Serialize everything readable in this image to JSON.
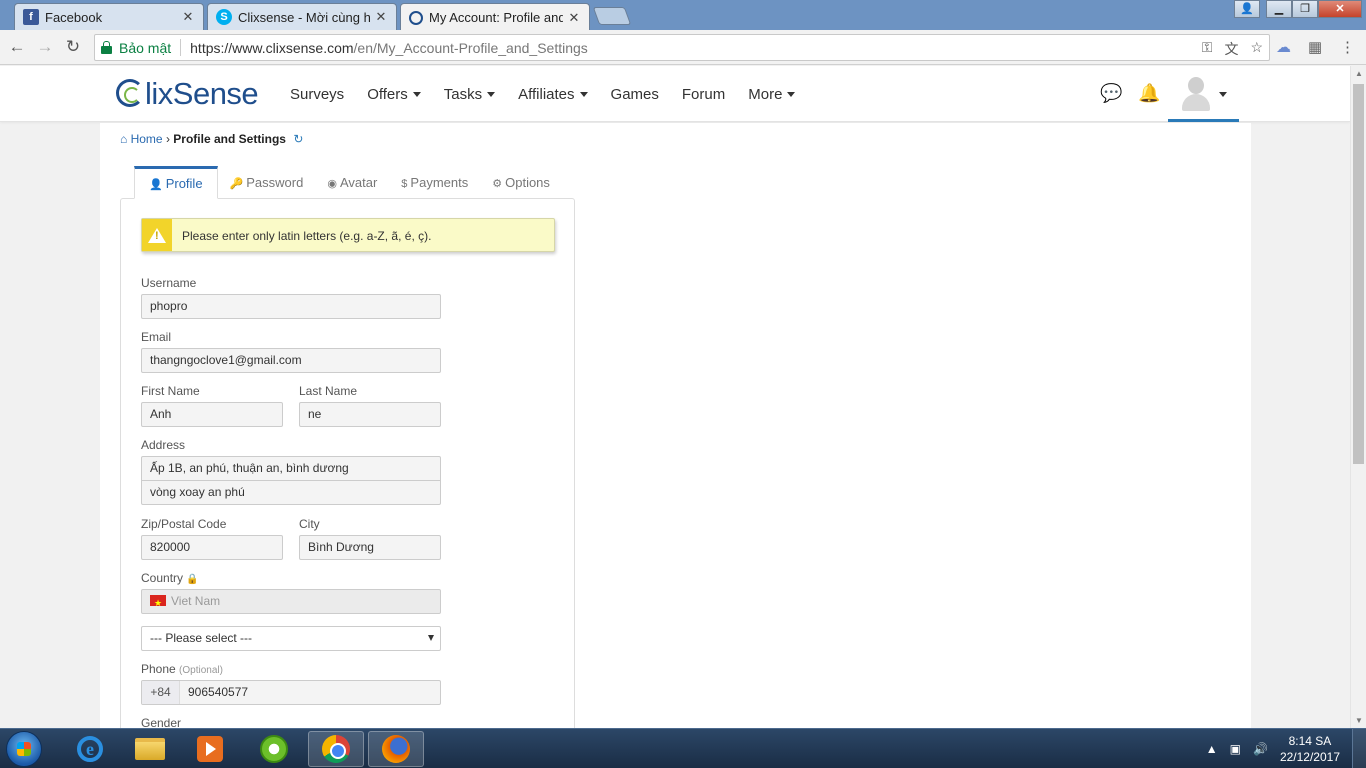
{
  "browser": {
    "tabs": [
      {
        "title": "Facebook",
        "icon": "facebook-icon",
        "color": "#3b5998"
      },
      {
        "title": "Clixsense - Mời cùng hợp",
        "icon": "skype-icon",
        "color": "#00aff0"
      },
      {
        "title": "My Account: Profile and S",
        "icon": "clixsense-icon",
        "color": "#1f4e8c"
      }
    ],
    "security_label": "Bảo mật",
    "url_host": "https://www.clixsense.com",
    "url_path": "/en/My_Account-Profile_and_Settings"
  },
  "site": {
    "logo": "lixSense",
    "nav": [
      {
        "label": "Surveys",
        "dropdown": false
      },
      {
        "label": "Offers",
        "dropdown": true
      },
      {
        "label": "Tasks",
        "dropdown": true
      },
      {
        "label": "Affiliates",
        "dropdown": true
      },
      {
        "label": "Games",
        "dropdown": false
      },
      {
        "label": "Forum",
        "dropdown": false
      },
      {
        "label": "More",
        "dropdown": true
      }
    ]
  },
  "breadcrumb": {
    "home": "Home",
    "current": "Profile and Settings"
  },
  "profile_tabs": [
    {
      "label": "Profile",
      "icon": "user-icon",
      "active": true
    },
    {
      "label": "Password",
      "icon": "key-icon",
      "active": false
    },
    {
      "label": "Avatar",
      "icon": "avatar-icon",
      "active": false
    },
    {
      "label": "Payments",
      "icon": "dollar-icon",
      "active": false
    },
    {
      "label": "Options",
      "icon": "gear-icon",
      "active": false
    }
  ],
  "form": {
    "warning": "Please enter only latin letters (e.g. a-Z, ã, é, ç).",
    "username_label": "Username",
    "username": "phopro",
    "email_label": "Email",
    "email": "thangngoclove1@gmail.com",
    "first_name_label": "First Name",
    "first_name": "Anh",
    "last_name_label": "Last Name",
    "last_name": "ne",
    "address_label": "Address",
    "address1": "Ấp 1B, an phú, thuận an, bình dương",
    "address2": "vòng xoay an phú",
    "zip_label": "Zip/Postal Code",
    "zip": "820000",
    "city_label": "City",
    "city": "Bình Dương",
    "country_label": "Country",
    "country": "Viet Nam",
    "region_select": "--- Please select ---",
    "phone_label": "Phone",
    "phone_optional": "(Optional)",
    "phone_prefix": "+84",
    "phone": "906540577",
    "gender_label": "Gender"
  },
  "taskbar": {
    "time": "8:14 SA",
    "date": "22/12/2017"
  },
  "colors": {
    "brand_blue": "#1f4e8c",
    "link_blue": "#2a6ab0",
    "warning_bg": "#fafac8",
    "secure_green": "#0b8043"
  }
}
